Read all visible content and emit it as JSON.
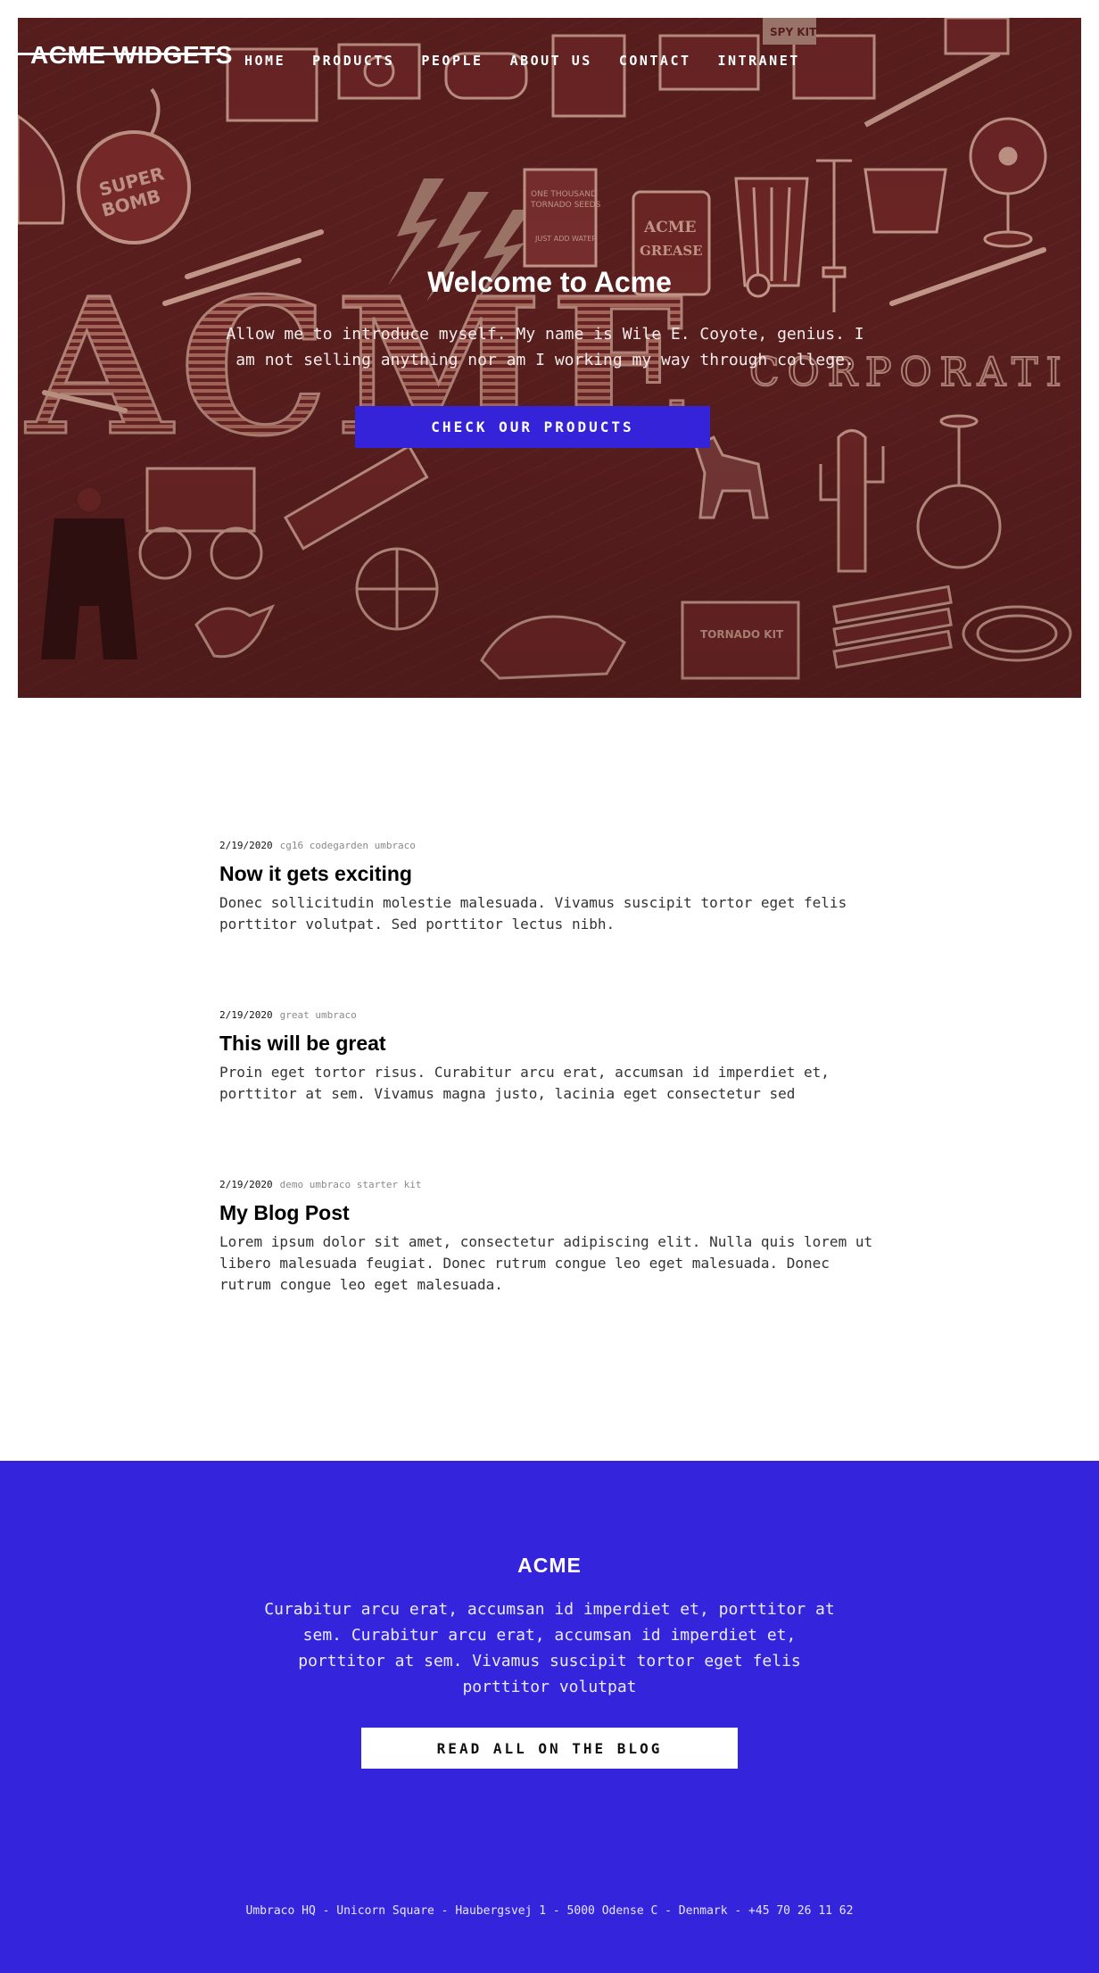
{
  "header": {
    "logo": "ACME WIDGETS",
    "nav": [
      "HOME",
      "PRODUCTS",
      "PEOPLE",
      "ABOUT US",
      "CONTACT",
      "INTRANET"
    ]
  },
  "hero": {
    "title": "Welcome to Acme",
    "text": "Allow me to introduce myself. My name is Wile E. Coyote, genius. I am not selling anything nor am I working my way through college.",
    "button": "CHECK OUR PRODUCTS",
    "background_color": "#5a1f1f",
    "background_text": "ACME CORPORATION"
  },
  "posts": [
    {
      "date": "2/19/2020",
      "tags": "cg16 codegarden umbraco",
      "title": "Now it gets exciting",
      "excerpt": "Donec sollicitudin molestie malesuada. Vivamus suscipit tortor eget felis porttitor volutpat. Sed porttitor lectus nibh."
    },
    {
      "date": "2/19/2020",
      "tags": "great umbraco",
      "title": "This will be great",
      "excerpt": "Proin eget tortor risus. Curabitur arcu erat, accumsan id imperdiet et, porttitor at sem. Vivamus magna justo, lacinia eget consectetur sed"
    },
    {
      "date": "2/19/2020",
      "tags": "demo umbraco starter kit",
      "title": "My Blog Post",
      "excerpt": "Lorem ipsum dolor sit amet, consectetur adipiscing elit. Nulla quis lorem ut libero malesuada feugiat. Donec rutrum congue leo eget malesuada. Donec rutrum congue leo eget malesuada."
    }
  ],
  "footer": {
    "title": "ACME",
    "text": "Curabitur arcu erat, accumsan id imperdiet et, porttitor at sem. Curabitur arcu erat, accumsan id imperdiet et, porttitor at sem. Vivamus suscipit tortor eget felis porttitor volutpat",
    "button": "READ ALL ON THE BLOG",
    "address": "Umbraco HQ - Unicorn Square - Haubergsvej 1 - 5000 Odense C - Denmark - +45 70 26 11 62",
    "background_color": "#3425dc"
  }
}
